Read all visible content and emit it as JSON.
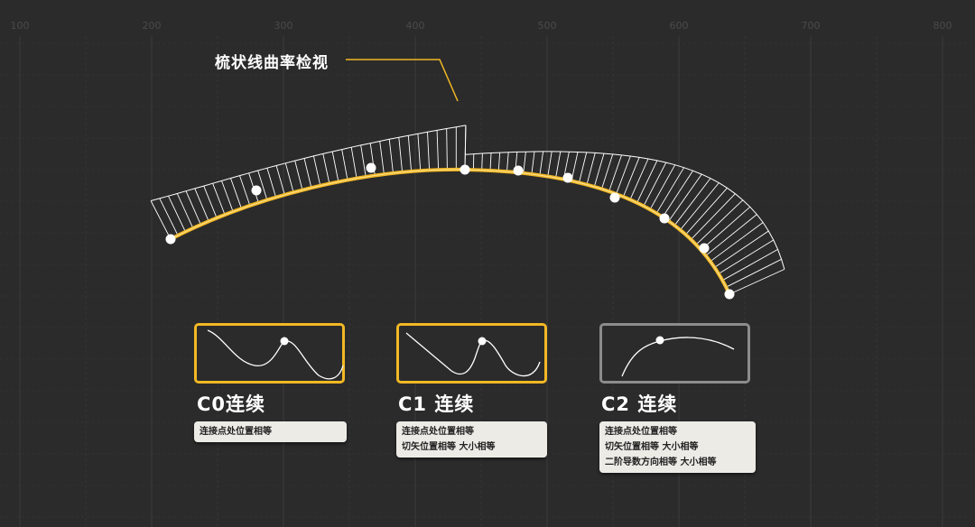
{
  "axis": {
    "ticks": [
      "100",
      "200",
      "300",
      "400",
      "500",
      "600",
      "700",
      "800"
    ]
  },
  "callout": {
    "label": "梳状线曲率检视"
  },
  "colors": {
    "curve": "#f2b824",
    "card_border_active": "#f2b824",
    "card_border_inactive": "#8c8c8c",
    "comb": "#ffffff",
    "background": "#2b2b2b",
    "grid": "#3b3b3b"
  },
  "cards": [
    {
      "title": "C0连续",
      "lines": [
        "连接点处位置相等"
      ],
      "style": "active"
    },
    {
      "title": "C1 连续",
      "lines": [
        "连接点处位置相等",
        "切矢位置相等 大小相等"
      ],
      "style": "active"
    },
    {
      "title": "C2 连续",
      "lines": [
        "连接点处位置相等",
        "切矢位置相等 大小相等",
        "二阶导数方向相等 大小相等"
      ],
      "style": "inactive"
    }
  ]
}
